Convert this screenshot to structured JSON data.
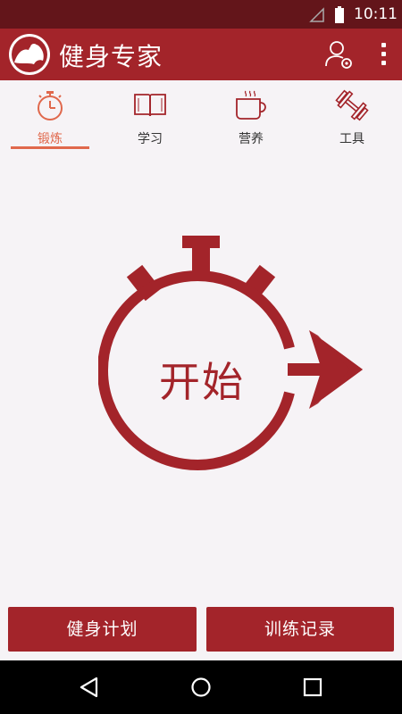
{
  "status_bar": {
    "time": "10:11"
  },
  "app_bar": {
    "title": "健身专家",
    "user_icon": "user-settings-icon",
    "menu_icon": "overflow-menu-icon"
  },
  "tabs": [
    {
      "label": "锻炼",
      "icon": "stopwatch-icon",
      "active": true
    },
    {
      "label": "学习",
      "icon": "open-book-icon",
      "active": false
    },
    {
      "label": "营养",
      "icon": "coffee-cup-icon",
      "active": false
    },
    {
      "label": "工具",
      "icon": "dumbbell-icon",
      "active": false
    }
  ],
  "main": {
    "start_label": "开始"
  },
  "bottom_buttons": {
    "plan_label": "健身计划",
    "record_label": "训练记录"
  },
  "colors": {
    "primary": "#a3242a",
    "status_bar": "#63151a",
    "accent": "#e0684c",
    "background": "#f6f3f6"
  }
}
